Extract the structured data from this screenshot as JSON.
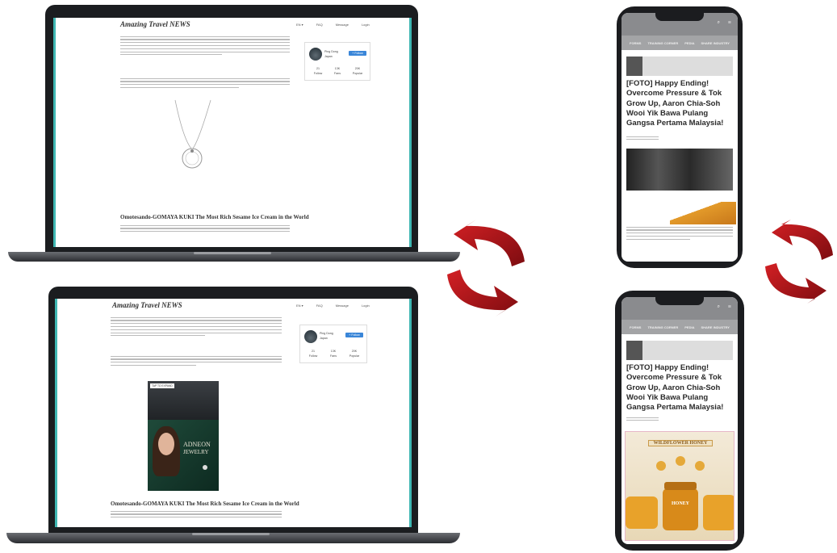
{
  "laptop_top": {
    "site_title": "Amazing Travel NEWS",
    "nav": [
      "EN ▾",
      "FAQ",
      "Message",
      "Login"
    ],
    "profile": {
      "name": "Ping Dong",
      "location": "Japan",
      "follow_label": "+ Follow",
      "stats": [
        {
          "value": "21",
          "label": "Follow"
        },
        {
          "value": "13K",
          "label": "Fans"
        },
        {
          "value": "20K",
          "label": "Popular"
        }
      ]
    },
    "article_heading": "Omotesando-GOMAYA KUKI The Most Rich Sesame Ice Cream in the World"
  },
  "laptop_bottom": {
    "site_title": "Amazing Travel NEWS",
    "nav": [
      "EN ▾",
      "FAQ",
      "Message",
      "Login"
    ],
    "profile": {
      "name": "Ping Dong",
      "location": "Japan",
      "follow_label": "+ Follow",
      "stats": [
        {
          "value": "21",
          "label": "Follow"
        },
        {
          "value": "13K",
          "label": "Fans"
        },
        {
          "value": "20K",
          "label": "Popular"
        }
      ]
    },
    "ad": {
      "tag": "TAP TO EXPAND",
      "brand": "ADNEON",
      "brand2": "JEWELRY"
    },
    "article_heading": "Omotesando-GOMAYA KUKI The Most Rich Sesame Ice Cream in the World"
  },
  "phone_top": {
    "nav": [
      "FORMS",
      "TRAINING CORNER",
      "PEDIA",
      "SHARE INDUSTRY"
    ],
    "headline": "[FOTO] Happy Ending! Overcome Pressure & Tok Grow Up, Aaron Chia-Soh Wooi Yik Bawa Pulang Gangsa Pertama Malaysia!"
  },
  "phone_bottom": {
    "nav": [
      "FORMS",
      "TRAINING CORNER",
      "PEDIA",
      "SHARE INDUSTRY"
    ],
    "headline": "[FOTO] Happy Ending! Overcome Pressure & Tok Grow Up, Aaron Chia-Soh Wooi Yik Bawa Pulang Gangsa Pertama Malaysia!",
    "ad": {
      "banner": "WILDFLOWER HONEY",
      "product": "HONEY"
    }
  },
  "colors": {
    "accent_teal": "#3fb7b3",
    "arrow_red": "#b3161a",
    "follow_blue": "#3a86d8"
  }
}
